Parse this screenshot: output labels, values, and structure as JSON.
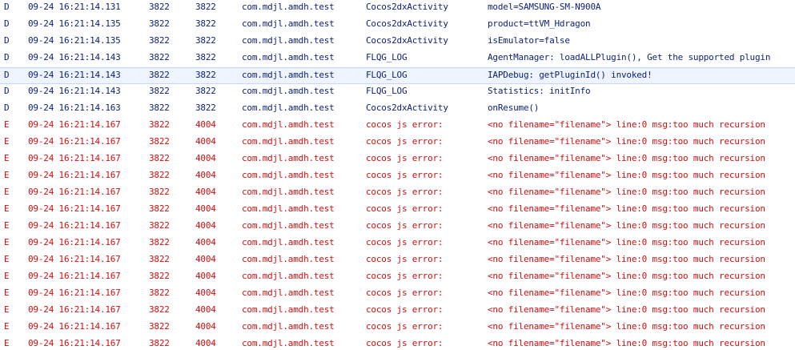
{
  "colors": {
    "debug": "#0b1f74",
    "error": "#d01010",
    "selected_background": "#eef4fd"
  },
  "log_rows": [
    {
      "level": "D",
      "time": "09-24 16:21:14.131",
      "pid": "3822",
      "tid": "3822",
      "application": "com.mdjl.amdh.test",
      "tag": "Cocos2dxActivity",
      "text": "model=SAMSUNG-SM-N900A",
      "selected": false
    },
    {
      "level": "D",
      "time": "09-24 16:21:14.135",
      "pid": "3822",
      "tid": "3822",
      "application": "com.mdjl.amdh.test",
      "tag": "Cocos2dxActivity",
      "text": "product=ttVM_Hdragon",
      "selected": false
    },
    {
      "level": "D",
      "time": "09-24 16:21:14.135",
      "pid": "3822",
      "tid": "3822",
      "application": "com.mdjl.amdh.test",
      "tag": "Cocos2dxActivity",
      "text": "isEmulator=false",
      "selected": false
    },
    {
      "level": "D",
      "time": "09-24 16:21:14.143",
      "pid": "3822",
      "tid": "3822",
      "application": "com.mdjl.amdh.test",
      "tag": "FLQG_LOG",
      "text": "AgentManager: loadALLPlugin(), Get the supported plugin",
      "selected": false
    },
    {
      "level": "D",
      "time": "09-24 16:21:14.143",
      "pid": "3822",
      "tid": "3822",
      "application": "com.mdjl.amdh.test",
      "tag": "FLQG_LOG",
      "text": "IAPDebug: getPluginId() invoked!",
      "selected": true
    },
    {
      "level": "D",
      "time": "09-24 16:21:14.143",
      "pid": "3822",
      "tid": "3822",
      "application": "com.mdjl.amdh.test",
      "tag": "FLQG_LOG",
      "text": "Statistics: initInfo",
      "selected": false
    },
    {
      "level": "D",
      "time": "09-24 16:21:14.163",
      "pid": "3822",
      "tid": "3822",
      "application": "com.mdjl.amdh.test",
      "tag": "Cocos2dxActivity",
      "text": "onResume()",
      "selected": false
    },
    {
      "level": "E",
      "time": "09-24 16:21:14.167",
      "pid": "3822",
      "tid": "4004",
      "application": "com.mdjl.amdh.test",
      "tag": "cocos js error:",
      "text": "<no filename=\"filename\"> line:0 msg:too much recursion",
      "selected": false
    },
    {
      "level": "E",
      "time": "09-24 16:21:14.167",
      "pid": "3822",
      "tid": "4004",
      "application": "com.mdjl.amdh.test",
      "tag": "cocos js error:",
      "text": "<no filename=\"filename\"> line:0 msg:too much recursion",
      "selected": false
    },
    {
      "level": "E",
      "time": "09-24 16:21:14.167",
      "pid": "3822",
      "tid": "4004",
      "application": "com.mdjl.amdh.test",
      "tag": "cocos js error:",
      "text": "<no filename=\"filename\"> line:0 msg:too much recursion",
      "selected": false
    },
    {
      "level": "E",
      "time": "09-24 16:21:14.167",
      "pid": "3822",
      "tid": "4004",
      "application": "com.mdjl.amdh.test",
      "tag": "cocos js error:",
      "text": "<no filename=\"filename\"> line:0 msg:too much recursion",
      "selected": false
    },
    {
      "level": "E",
      "time": "09-24 16:21:14.167",
      "pid": "3822",
      "tid": "4004",
      "application": "com.mdjl.amdh.test",
      "tag": "cocos js error:",
      "text": "<no filename=\"filename\"> line:0 msg:too much recursion",
      "selected": false
    },
    {
      "level": "E",
      "time": "09-24 16:21:14.167",
      "pid": "3822",
      "tid": "4004",
      "application": "com.mdjl.amdh.test",
      "tag": "cocos js error:",
      "text": "<no filename=\"filename\"> line:0 msg:too much recursion",
      "selected": false
    },
    {
      "level": "E",
      "time": "09-24 16:21:14.167",
      "pid": "3822",
      "tid": "4004",
      "application": "com.mdjl.amdh.test",
      "tag": "cocos js error:",
      "text": "<no filename=\"filename\"> line:0 msg:too much recursion",
      "selected": false
    },
    {
      "level": "E",
      "time": "09-24 16:21:14.167",
      "pid": "3822",
      "tid": "4004",
      "application": "com.mdjl.amdh.test",
      "tag": "cocos js error:",
      "text": "<no filename=\"filename\"> line:0 msg:too much recursion",
      "selected": false
    },
    {
      "level": "E",
      "time": "09-24 16:21:14.167",
      "pid": "3822",
      "tid": "4004",
      "application": "com.mdjl.amdh.test",
      "tag": "cocos js error:",
      "text": "<no filename=\"filename\"> line:0 msg:too much recursion",
      "selected": false
    },
    {
      "level": "E",
      "time": "09-24 16:21:14.167",
      "pid": "3822",
      "tid": "4004",
      "application": "com.mdjl.amdh.test",
      "tag": "cocos js error:",
      "text": "<no filename=\"filename\"> line:0 msg:too much recursion",
      "selected": false
    },
    {
      "level": "E",
      "time": "09-24 16:21:14.167",
      "pid": "3822",
      "tid": "4004",
      "application": "com.mdjl.amdh.test",
      "tag": "cocos js error:",
      "text": "<no filename=\"filename\"> line:0 msg:too much recursion",
      "selected": false
    },
    {
      "level": "E",
      "time": "09-24 16:21:14.167",
      "pid": "3822",
      "tid": "4004",
      "application": "com.mdjl.amdh.test",
      "tag": "cocos js error:",
      "text": "<no filename=\"filename\"> line:0 msg:too much recursion",
      "selected": false
    },
    {
      "level": "E",
      "time": "09-24 16:21:14.167",
      "pid": "3822",
      "tid": "4004",
      "application": "com.mdjl.amdh.test",
      "tag": "cocos js error:",
      "text": "<no filename=\"filename\"> line:0 msg:too much recursion",
      "selected": false
    },
    {
      "level": "E",
      "time": "09-24 16:21:14.167",
      "pid": "3822",
      "tid": "4004",
      "application": "com.mdjl.amdh.test",
      "tag": "cocos js error:",
      "text": "<no filename=\"filename\"> line:0 msg:too much recursion",
      "selected": false
    }
  ]
}
